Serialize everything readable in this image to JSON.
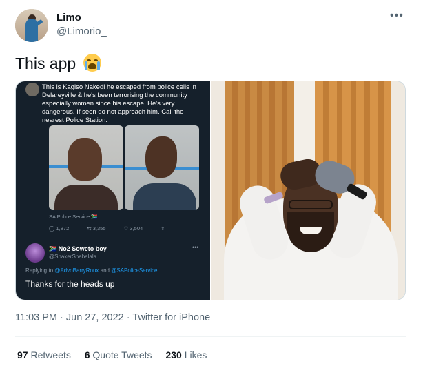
{
  "author": {
    "name": "Limo",
    "handle": "@Limorio_"
  },
  "more_icon": "more-horizontal-icon",
  "tweet": {
    "text": "This app",
    "emoji": "loudly-crying-face"
  },
  "embedded_tweet": {
    "text": "This is Kagiso Nakedi he escaped from police cells in Delareyville & he's been terrorising the community especially women since his escape. He's very dangerous. If seen do not approach him. Call the nearest Police Station.",
    "source": "SA Police Service 🇿🇦",
    "replies": "1,872",
    "retweets": "3,355",
    "likes": "3,504",
    "reply": {
      "name": "🇿🇦 No2 Soweto boy",
      "handle": "@ShakerShabalala",
      "replying_prefix": "Replying to",
      "replying_to_1": "@AdvoBarryRoux",
      "replying_and": "and",
      "replying_to_2": "@SAPoliceService",
      "text": "Thanks for the heads up"
    }
  },
  "meta": {
    "timestamp": "11:03 PM · Jun 27, 2022 · Twitter for iPhone"
  },
  "stats": {
    "retweets_count": "97",
    "retweets_label": "Retweets",
    "quotes_count": "6",
    "quotes_label": "Quote Tweets",
    "likes_count": "230",
    "likes_label": "Likes"
  },
  "colors": {
    "text": "#0f1419",
    "secondary": "#536471",
    "link": "#1d9bf0",
    "dark_bg": "#15202b"
  }
}
